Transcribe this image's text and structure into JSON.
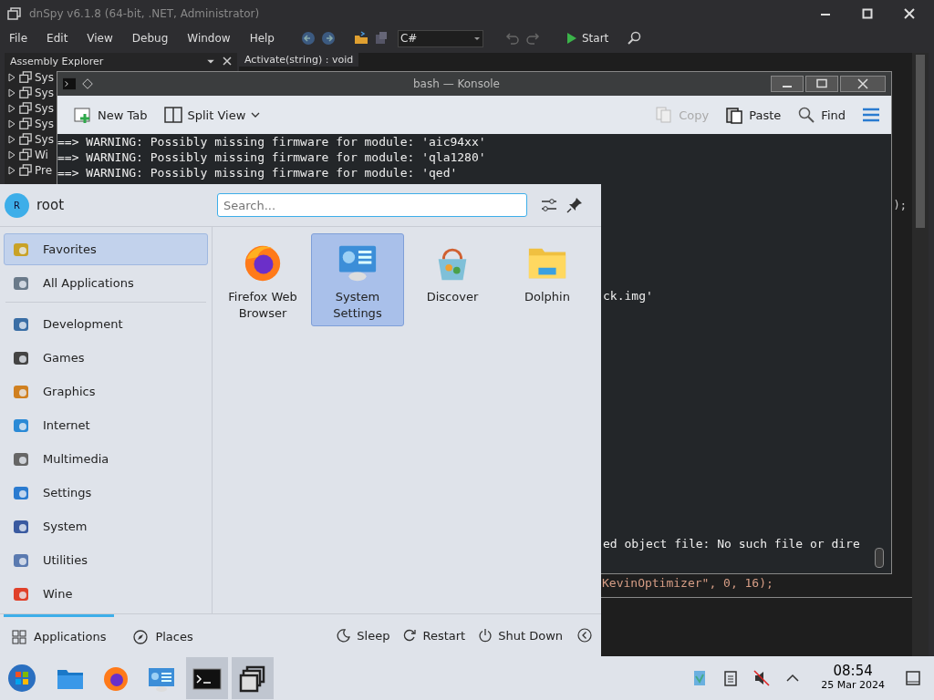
{
  "dnspy": {
    "title": "dnSpy v6.1.8 (64-bit, .NET, Administrator)",
    "menu": [
      "File",
      "Edit",
      "View",
      "Debug",
      "Window",
      "Help"
    ],
    "language": "C#",
    "start": "Start",
    "explorer": {
      "title": "Assembly Explorer",
      "items": [
        "Sys",
        "Sys",
        "Sys",
        "Sys",
        "Sys",
        "Wi",
        "Pre"
      ]
    },
    "tab": "Activate(string) : void",
    "code_fragment": ");",
    "code_bottom": "KevinOptimizer\", 0, 16);"
  },
  "konsole": {
    "title": "bash — Konsole",
    "toolbar": [
      {
        "kind": "newtab",
        "label": "New Tab",
        "disabled": false
      },
      {
        "kind": "split",
        "label": "Split View",
        "disabled": false
      },
      {
        "kind": "copy",
        "label": "Copy",
        "disabled": true
      },
      {
        "kind": "paste",
        "label": "Paste",
        "disabled": false
      },
      {
        "kind": "find",
        "label": "Find",
        "disabled": false
      }
    ],
    "lines": [
      "==> WARNING: Possibly missing firmware for module: 'aic94xx'",
      "==> WARNING: Possibly missing firmware for module: 'qla1280'",
      "==> WARNING: Possibly missing firmware for module: 'qed'"
    ],
    "fragments": [
      "ck.img'",
      "ed object file: No such file or dire"
    ]
  },
  "launcher": {
    "avatar": "R",
    "user": "root",
    "search": {
      "placeholder": "Search..."
    },
    "categories": [
      {
        "label": "Favorites",
        "selected": true
      },
      {
        "label": "All Applications",
        "selected": false
      },
      {
        "label": "Development",
        "selected": false
      },
      {
        "label": "Games",
        "selected": false
      },
      {
        "label": "Graphics",
        "selected": false
      },
      {
        "label": "Internet",
        "selected": false
      },
      {
        "label": "Multimedia",
        "selected": false
      },
      {
        "label": "Settings",
        "selected": false
      },
      {
        "label": "System",
        "selected": false
      },
      {
        "label": "Utilities",
        "selected": false
      },
      {
        "label": "Wine",
        "selected": false
      }
    ],
    "apps": [
      {
        "kind": "firefox",
        "label": "Firefox Web Browser",
        "selected": false
      },
      {
        "kind": "settings",
        "label": "System Settings",
        "selected": true
      },
      {
        "kind": "discover",
        "label": "Discover",
        "selected": false
      },
      {
        "kind": "dolphin",
        "label": "Dolphin",
        "selected": false
      }
    ],
    "tabs": [
      {
        "label": "Applications",
        "selected": true
      },
      {
        "label": "Places",
        "selected": false
      }
    ],
    "power": [
      {
        "kind": "sleep",
        "label": "Sleep"
      },
      {
        "kind": "restart",
        "label": "Restart"
      },
      {
        "kind": "shutdown",
        "label": "Shut Down"
      }
    ]
  },
  "taskbar": {
    "tasks": [
      {
        "kind": "files",
        "active": false
      },
      {
        "kind": "firefox",
        "active": false
      },
      {
        "kind": "settings",
        "active": false
      },
      {
        "kind": "terminal",
        "active": true
      },
      {
        "kind": "windows",
        "active": true
      }
    ],
    "time": "08:54",
    "date": "25 Mar 2024"
  }
}
